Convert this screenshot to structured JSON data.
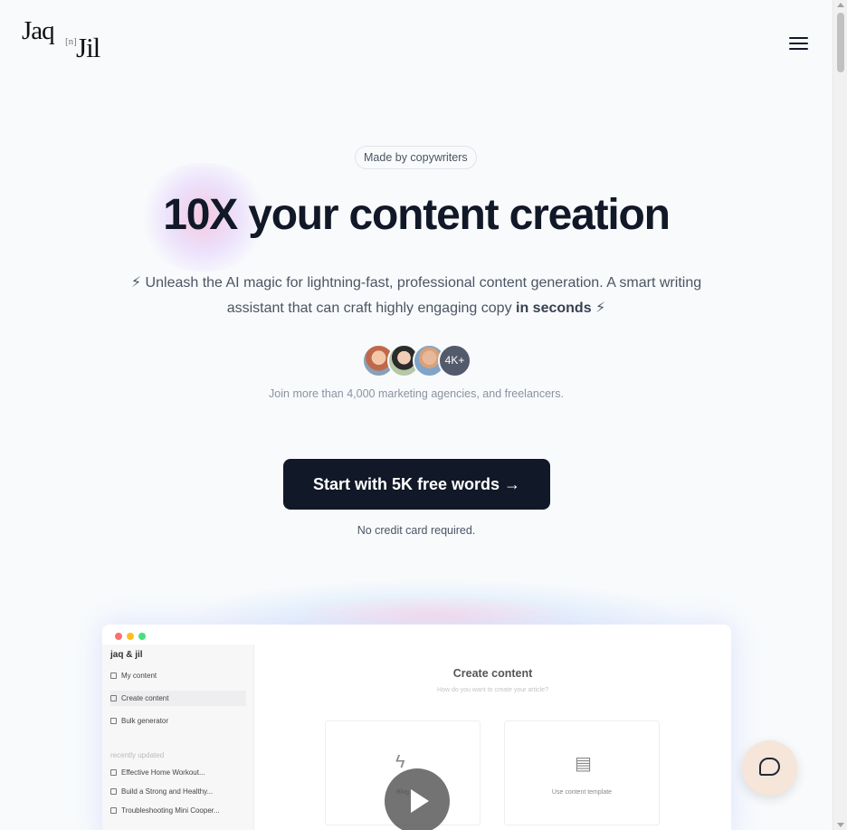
{
  "header": {
    "logo_word1": "Jaq",
    "logo_mid": "[n]",
    "logo_word2": "Jil",
    "menu_icon": "hamburger-icon"
  },
  "hero": {
    "badge": "Made by copywriters",
    "title": "10X your content creation",
    "sub_prefix": "⚡ Unleash the AI magic for lightning-fast, professional content generation. A smart writing assistant that can craft highly engaging copy ",
    "sub_bold": "in seconds",
    "sub_suffix": " ⚡",
    "avatar_count": "4K+",
    "join_text": "Join more than 4,000 marketing agencies, and freelancers.",
    "cta_label": "Start with 5K free words →",
    "no_credit": "No credit card required."
  },
  "preview": {
    "brand": "jaq & jil",
    "nav": [
      "My content",
      "Create content",
      "Bulk generator"
    ],
    "section_label": "recently updated",
    "recent": [
      "Effective Home Workout...",
      "Build a Strong and Healthy...",
      "Troubleshooting Mini Cooper..."
    ],
    "main_title": "Create content",
    "main_sub": "How do you want to create your article?",
    "cards": [
      "Blog",
      "Use content template"
    ]
  },
  "colors": {
    "background": "#f8fafc",
    "cta": "#111827",
    "chat_button": "#f6e6d9"
  }
}
